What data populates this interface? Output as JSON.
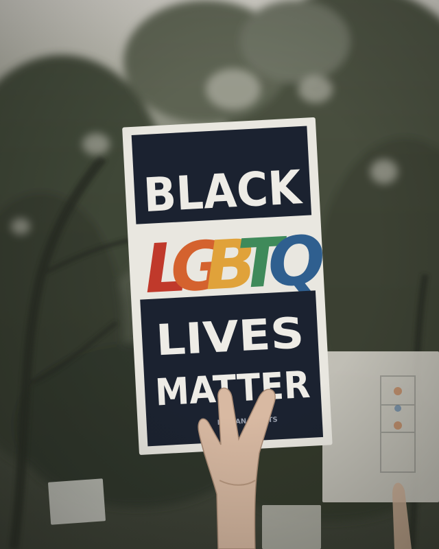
{
  "sign": {
    "line1": "BLACK",
    "line2_letters": [
      "L",
      "G",
      "B",
      "T",
      "Q"
    ],
    "line3": "LIVES",
    "line4": "MATTER",
    "small_print": "HUMAN RIGHTS"
  },
  "colors": {
    "sign_navy": "#1b2230",
    "sign_paper": "#e9e7e0",
    "rainbow": [
      "#c0392b",
      "#d4622e",
      "#e0a23a",
      "#3f8a5a",
      "#2f5f8f"
    ]
  },
  "scene": {
    "subject": "protest-sign-held-by-raised-hand",
    "background": "blurred-trees-and-crowd"
  }
}
